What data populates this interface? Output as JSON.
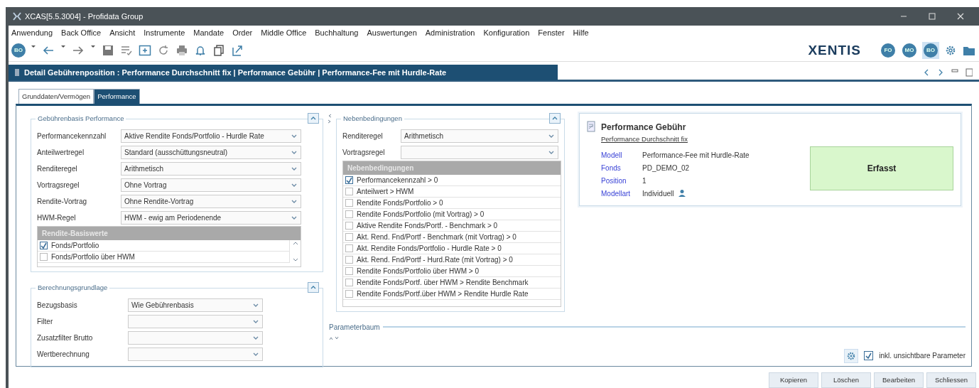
{
  "window": {
    "title": "XCAS[5.5.3004] - Profidata Group"
  },
  "menu": [
    "Anwendung",
    "Back Office",
    "Ansicht",
    "Instrumente",
    "Mandate",
    "Order",
    "Middle Office",
    "Buchhaltung",
    "Auswertungen",
    "Administration",
    "Konfiguration",
    "Fenster",
    "Hilfe"
  ],
  "toolbar": {
    "user_badge": "BO",
    "logo": "XENTIS",
    "modules": [
      {
        "label": "FO",
        "selected": false
      },
      {
        "label": "MO",
        "selected": false
      },
      {
        "label": "BO",
        "selected": true
      }
    ]
  },
  "detail": {
    "title": "Detail Gebührenposition : Performance Durchschnitt fix | Performance Gebühr | Performance-Fee mit Hurdle-Rate"
  },
  "tabs": [
    {
      "label": "Grunddaten/Vermögen",
      "selected": false
    },
    {
      "label": "Performance",
      "selected": true
    }
  ],
  "gebuehrenbasis": {
    "title": "Gebührenbasis Performance",
    "fields": [
      {
        "label": "Performancekennzahl",
        "value": "Aktive Rendite Fonds/Portfolio - Hurdle Rate"
      },
      {
        "label": "Anteilwertregel",
        "value": "Standard (ausschüttungsneutral)"
      },
      {
        "label": "Renditeregel",
        "value": "Arithmetisch"
      },
      {
        "label": "Vortragsregel",
        "value": "Ohne Vortrag"
      },
      {
        "label": "Rendite-Vortrag",
        "value": "Ohne Rendite-Vortrag"
      },
      {
        "label": "HWM-Regel",
        "value": "HWM - ewig am Periodenende"
      }
    ],
    "list": {
      "header": "Rendite-Basiswerte",
      "items": [
        {
          "label": "Fonds/Portfolio",
          "checked": true
        },
        {
          "label": "Fonds/Portfolio über HWM",
          "checked": false
        }
      ]
    }
  },
  "berechnungsgrundlage": {
    "title": "Berechnungsgrundlage",
    "fields": [
      {
        "label": "Bezugsbasis",
        "value": "Wie Gebührenbasis"
      },
      {
        "label": "Filter"
      },
      {
        "label": "Zusatzfilter Brutto"
      },
      {
        "label": "Wertberechnung"
      }
    ]
  },
  "nebenbedingungen": {
    "title": "Nebenbedingungen",
    "fields": [
      {
        "label": "Renditeregel",
        "value": "Arithmetisch"
      },
      {
        "label": "Vortragsregel"
      }
    ],
    "list": {
      "header": "Nebenbedingungen",
      "items": [
        {
          "label": "Performancekennzahl > 0",
          "checked": true
        },
        {
          "label": "Anteilwert > HWM",
          "checked": false
        },
        {
          "label": "Rendite Fonds/Portfolio > 0",
          "checked": false
        },
        {
          "label": "Rendite Fonds/Portfolio (mit Vortrag) > 0",
          "checked": false
        },
        {
          "label": "Aktive Rendite Fonds/Portf. - Benchmark > 0",
          "checked": false
        },
        {
          "label": "Akt. Rend. Fnd/Portf - Benchmark (mit Vortrag) > 0",
          "checked": false
        },
        {
          "label": "Akt. Rendite Fonds/Portfolio - Hurdle Rate > 0",
          "checked": false
        },
        {
          "label": "Akt. Rend. Fnd/Portf - Hurd.Rate (mit Vortrag) > 0",
          "checked": false
        },
        {
          "label": "Rendite Fonds/Portfolio über HWM > 0",
          "checked": false
        },
        {
          "label": "Rendite Fonds/Portf. über HWM > Rendite Benchmark",
          "checked": false
        },
        {
          "label": "Rendite Fonds/Portf.über HWM > Rendite Hurdle Rate",
          "checked": false
        }
      ]
    }
  },
  "summary": {
    "title": "Performance Gebühr",
    "link": "Performance Durchschnitt fix",
    "rows": [
      {
        "label": "Modell",
        "value": "Performance-Fee mit Hurdle-Rate"
      },
      {
        "label": "Fonds",
        "value": "PD_DEMO_02"
      },
      {
        "label": "Position",
        "value": "1"
      },
      {
        "label": "Modellart",
        "value": "Individuell"
      }
    ],
    "status": "Erfasst"
  },
  "parameterbaum": {
    "title": "Parameterbaum"
  },
  "option": {
    "label": "inkl. unsichtbare Parameter",
    "checked": true
  },
  "buttons": [
    "Kopieren",
    "Löschen",
    "Bearbeiten",
    "Schliessen"
  ]
}
